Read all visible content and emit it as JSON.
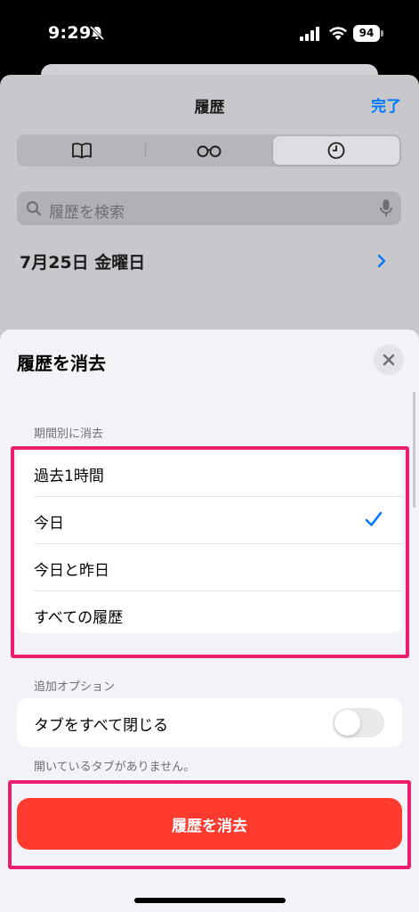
{
  "status_bar": {
    "time": "9:29",
    "battery": "94"
  },
  "history": {
    "title": "履歴",
    "done_label": "完了",
    "tabs": [
      {
        "icon": "book-icon",
        "active": false
      },
      {
        "icon": "glasses-icon",
        "active": false
      },
      {
        "icon": "clock-icon",
        "active": true
      }
    ],
    "search_placeholder": "履歴を検索",
    "date_heading": "7月25日 金曜日"
  },
  "clear_sheet": {
    "title": "履歴を消去",
    "period_section_label": "期間別に消去",
    "periods": [
      {
        "label": "過去1時間",
        "selected": false
      },
      {
        "label": "今日",
        "selected": true
      },
      {
        "label": "今日と昨日",
        "selected": false
      },
      {
        "label": "すべての履歴",
        "selected": false
      }
    ],
    "options_section_label": "追加オプション",
    "close_tabs_label": "タブをすべて閉じる",
    "close_tabs_on": false,
    "note": "開いているタブがありません。",
    "clear_button_label": "履歴を消去"
  },
  "colors": {
    "accent": "#007aff",
    "destructive": "#ff3b30",
    "highlight": "#ec1d6e"
  }
}
